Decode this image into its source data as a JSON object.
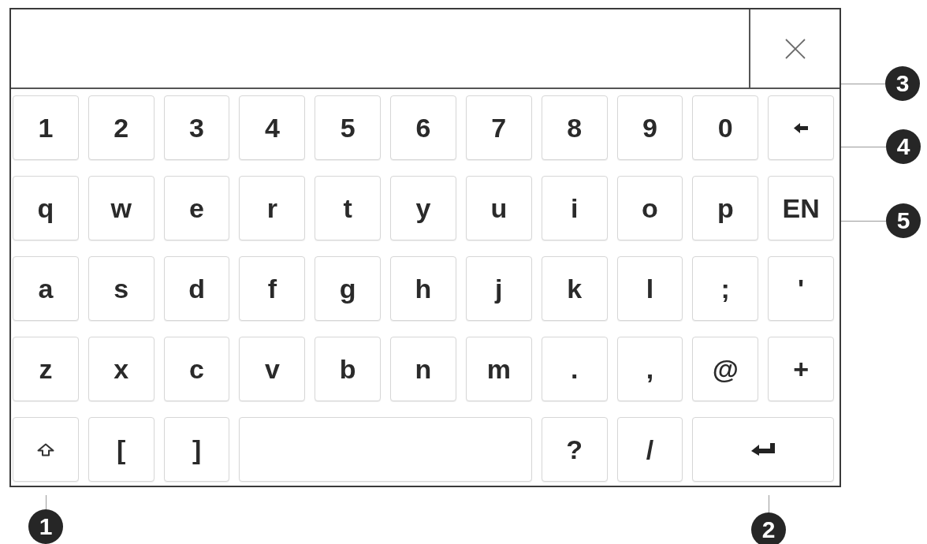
{
  "close_button": {
    "callout": "3"
  },
  "keyboard": {
    "rows": [
      [
        {
          "kind": "char",
          "label": "1"
        },
        {
          "kind": "char",
          "label": "2"
        },
        {
          "kind": "char",
          "label": "3"
        },
        {
          "kind": "char",
          "label": "4"
        },
        {
          "kind": "char",
          "label": "5"
        },
        {
          "kind": "char",
          "label": "6"
        },
        {
          "kind": "char",
          "label": "7"
        },
        {
          "kind": "char",
          "label": "8"
        },
        {
          "kind": "char",
          "label": "9"
        },
        {
          "kind": "char",
          "label": "0"
        },
        {
          "kind": "backspace",
          "callout": "4"
        }
      ],
      [
        {
          "kind": "char",
          "label": "q"
        },
        {
          "kind": "char",
          "label": "w"
        },
        {
          "kind": "char",
          "label": "e"
        },
        {
          "kind": "char",
          "label": "r"
        },
        {
          "kind": "char",
          "label": "t"
        },
        {
          "kind": "char",
          "label": "y"
        },
        {
          "kind": "char",
          "label": "u"
        },
        {
          "kind": "char",
          "label": "i"
        },
        {
          "kind": "char",
          "label": "o"
        },
        {
          "kind": "char",
          "label": "p"
        },
        {
          "kind": "language",
          "label": "EN",
          "callout": "5"
        }
      ],
      [
        {
          "kind": "char",
          "label": "a"
        },
        {
          "kind": "char",
          "label": "s"
        },
        {
          "kind": "char",
          "label": "d"
        },
        {
          "kind": "char",
          "label": "f"
        },
        {
          "kind": "char",
          "label": "g"
        },
        {
          "kind": "char",
          "label": "h"
        },
        {
          "kind": "char",
          "label": "j"
        },
        {
          "kind": "char",
          "label": "k"
        },
        {
          "kind": "char",
          "label": "l"
        },
        {
          "kind": "char",
          "label": ";"
        },
        {
          "kind": "char",
          "label": "'"
        }
      ],
      [
        {
          "kind": "char",
          "label": "z"
        },
        {
          "kind": "char",
          "label": "x"
        },
        {
          "kind": "char",
          "label": "c"
        },
        {
          "kind": "char",
          "label": "v"
        },
        {
          "kind": "char",
          "label": "b"
        },
        {
          "kind": "char",
          "label": "n"
        },
        {
          "kind": "char",
          "label": "m"
        },
        {
          "kind": "char",
          "label": "."
        },
        {
          "kind": "char",
          "label": ","
        },
        {
          "kind": "char",
          "label": "@"
        },
        {
          "kind": "char",
          "label": "+"
        }
      ],
      [
        {
          "kind": "shift",
          "callout": "1"
        },
        {
          "kind": "char",
          "label": "["
        },
        {
          "kind": "char",
          "label": "]"
        },
        {
          "kind": "space"
        },
        "",
        "",
        "",
        {
          "kind": "char",
          "label": "?"
        },
        {
          "kind": "char",
          "label": "/"
        },
        {
          "kind": "enter",
          "callout": "2"
        },
        ""
      ]
    ]
  }
}
